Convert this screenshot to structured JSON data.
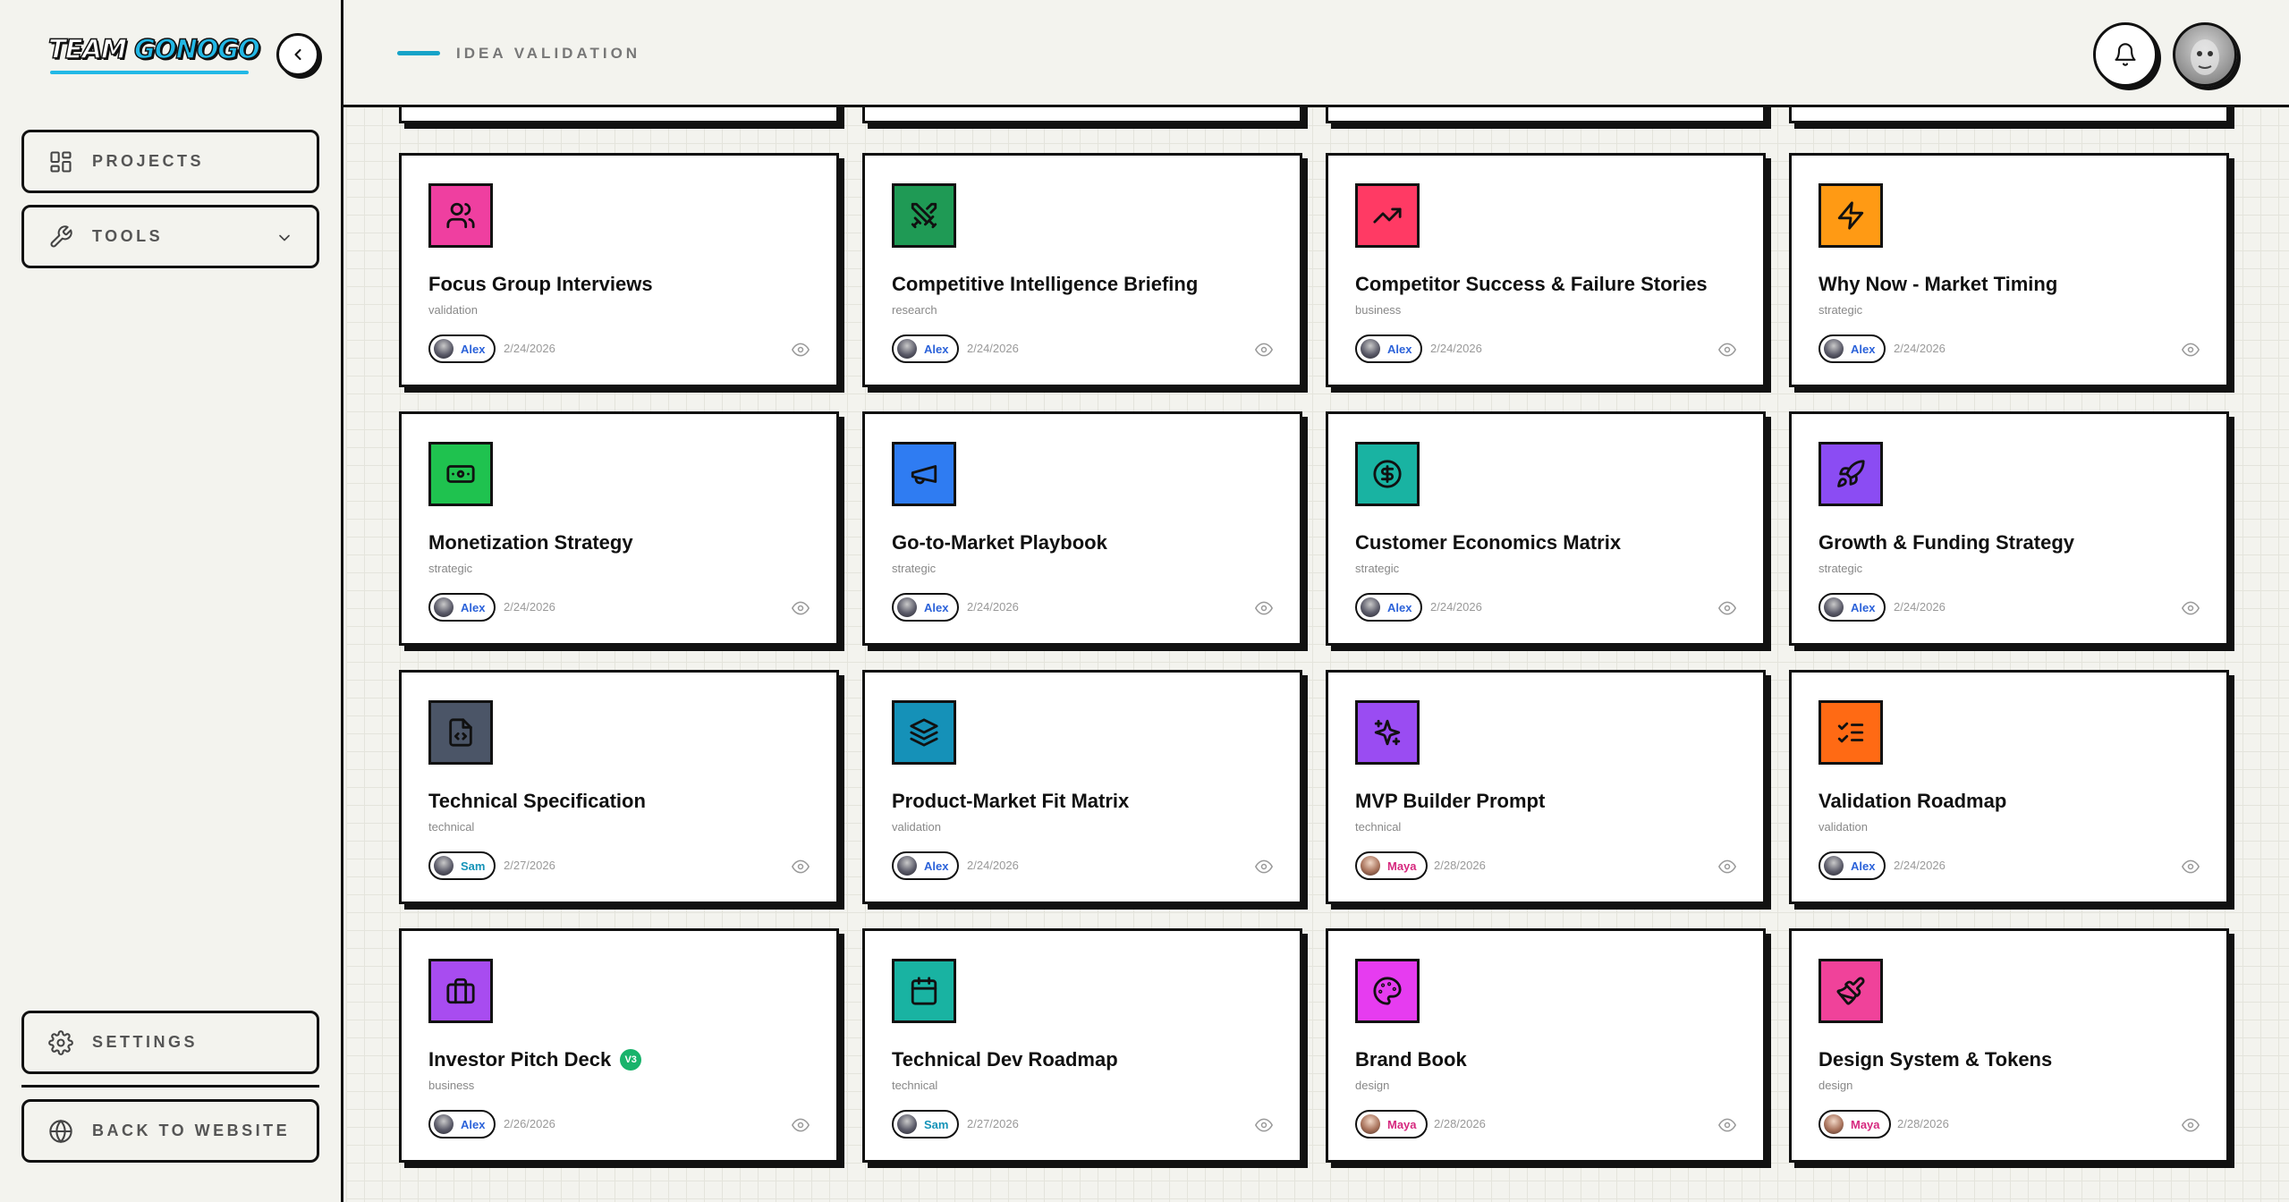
{
  "brand": {
    "logo_part1": "TEAM ",
    "logo_part2": "GONOGO",
    "accent_color": "#22b8e6"
  },
  "sidebar": {
    "collapse_icon": "chevron-left-icon",
    "projects_label": "PROJECTS",
    "tools_label": "TOOLS",
    "settings_label": "SETTINGS",
    "back_label": "BACK TO WEBSITE"
  },
  "header": {
    "breadcrumb": "IDEA VALIDATION",
    "bell_icon": "bell-icon"
  },
  "cards": [
    {
      "title": "Focus Group Interviews",
      "category": "validation",
      "user": "Alex",
      "date": "2/24/2026",
      "color": "#ef3fa0",
      "icon": "users-icon",
      "badge": ""
    },
    {
      "title": "Competitive Intelligence Briefing",
      "category": "research",
      "user": "Alex",
      "date": "2/24/2026",
      "color": "#1f9a55",
      "icon": "swords-icon",
      "badge": ""
    },
    {
      "title": "Competitor Success & Failure Stories",
      "category": "business",
      "user": "Alex",
      "date": "2/24/2026",
      "color": "#ff3a64",
      "icon": "trending-up-icon",
      "badge": ""
    },
    {
      "title": "Why Now - Market Timing",
      "category": "strategic",
      "user": "Alex",
      "date": "2/24/2026",
      "color": "#ff9a14",
      "icon": "lightning-icon",
      "badge": ""
    },
    {
      "title": "Monetization Strategy",
      "category": "strategic",
      "user": "Alex",
      "date": "2/24/2026",
      "color": "#1fc24f",
      "icon": "banknote-icon",
      "badge": ""
    },
    {
      "title": "Go-to-Market Playbook",
      "category": "strategic",
      "user": "Alex",
      "date": "2/24/2026",
      "color": "#2f7cf2",
      "icon": "megaphone-icon",
      "badge": ""
    },
    {
      "title": "Customer Economics Matrix",
      "category": "strategic",
      "user": "Alex",
      "date": "2/24/2026",
      "color": "#19b3a2",
      "icon": "dollar-circle-icon",
      "badge": ""
    },
    {
      "title": "Growth & Funding Strategy",
      "category": "strategic",
      "user": "Alex",
      "date": "2/24/2026",
      "color": "#8b4cf3",
      "icon": "rocket-icon",
      "badge": ""
    },
    {
      "title": "Technical Specification",
      "category": "technical",
      "user": "Sam",
      "date": "2/27/2026",
      "color": "#4b5567",
      "icon": "file-code-icon",
      "badge": ""
    },
    {
      "title": "Product-Market Fit Matrix",
      "category": "validation",
      "user": "Alex",
      "date": "2/24/2026",
      "color": "#1591b8",
      "icon": "layers-icon",
      "badge": ""
    },
    {
      "title": "MVP Builder Prompt",
      "category": "technical",
      "user": "Maya",
      "date": "2/28/2026",
      "color": "#9a4cf2",
      "icon": "sparkles-icon",
      "badge": ""
    },
    {
      "title": "Validation Roadmap",
      "category": "validation",
      "user": "Alex",
      "date": "2/24/2026",
      "color": "#ff6a14",
      "icon": "list-checks-icon",
      "badge": ""
    },
    {
      "title": "Investor Pitch Deck",
      "category": "business",
      "user": "Alex",
      "date": "2/26/2026",
      "color": "#a84cf0",
      "icon": "briefcase-icon",
      "badge": "V3"
    },
    {
      "title": "Technical Dev Roadmap",
      "category": "technical",
      "user": "Sam",
      "date": "2/27/2026",
      "color": "#19b3a2",
      "icon": "calendar-icon",
      "badge": ""
    },
    {
      "title": "Brand Book",
      "category": "design",
      "user": "Maya",
      "date": "2/28/2026",
      "color": "#e63cf0",
      "icon": "palette-icon",
      "badge": ""
    },
    {
      "title": "Design System & Tokens",
      "category": "design",
      "user": "Maya",
      "date": "2/28/2026",
      "color": "#f0429a",
      "icon": "paintbrush-icon",
      "badge": ""
    }
  ],
  "user_colors": {
    "Alex": "#2b62d9",
    "Sam": "#1593b8",
    "Maya": "#d6287e"
  }
}
